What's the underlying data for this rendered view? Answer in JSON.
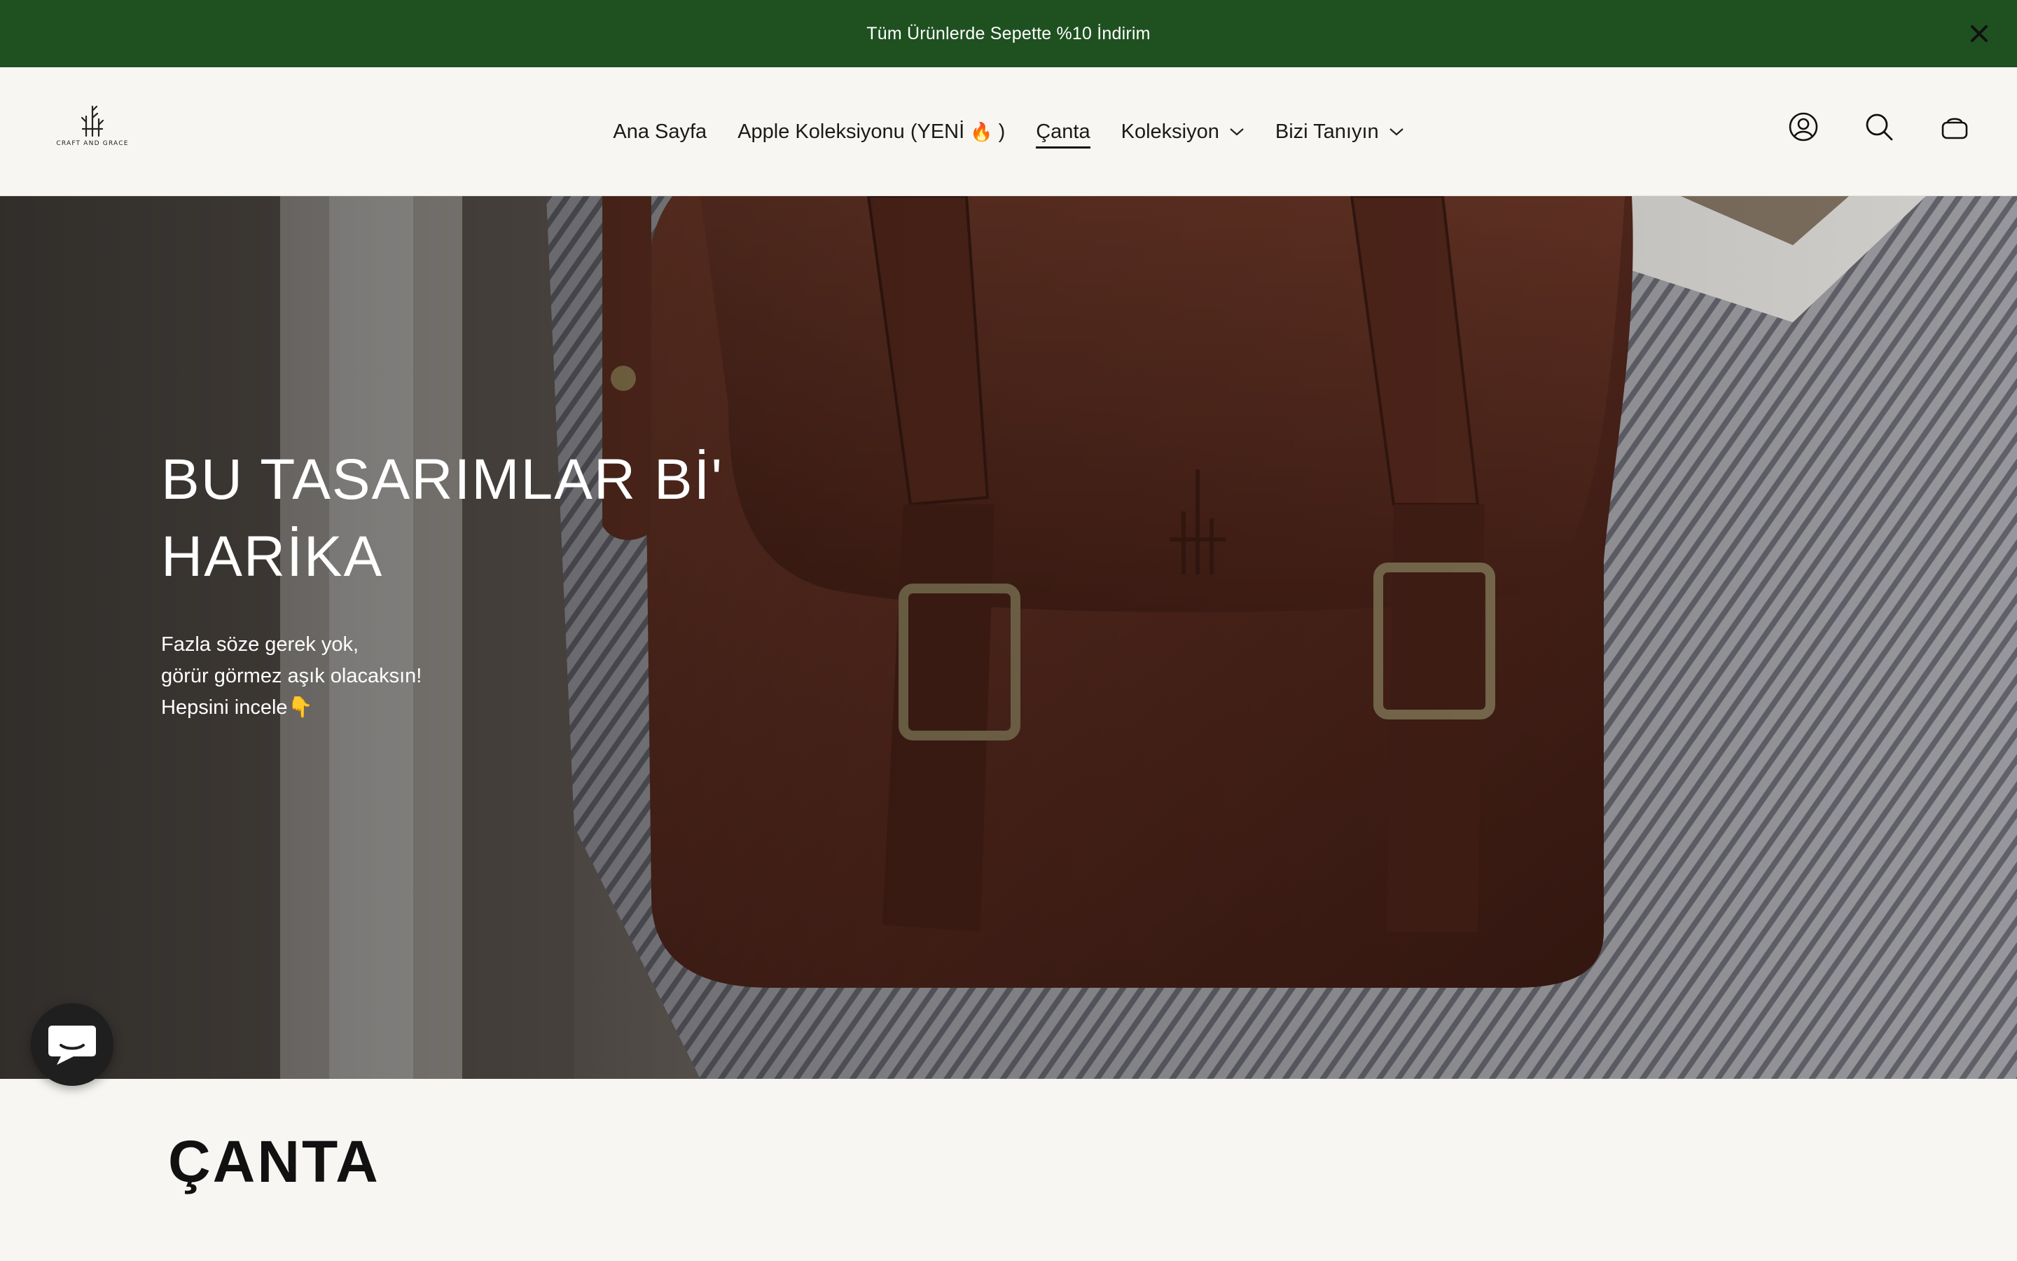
{
  "announcement": {
    "text": "Tüm Ürünlerde Sepette %10 İndirim",
    "close_icon": "close-icon",
    "bg_color": "#1f5120"
  },
  "header": {
    "logo_text": "CRAFT AND GRACE",
    "nav": [
      {
        "label": "Ana Sayfa"
      },
      {
        "label": "Apple Koleksiyonu (YENİ",
        "emoji": "🔥",
        "suffix": ")"
      },
      {
        "label": "Çanta"
      },
      {
        "label": "Koleksiyon"
      },
      {
        "label": "Bizi Tanıyın"
      }
    ],
    "active_nav": "Çanta",
    "icons": [
      "account-icon",
      "search-icon",
      "cart-icon"
    ]
  },
  "hero": {
    "title_line1": "BU TASARIMLAR Bİ'",
    "title_line2": "HARİKA",
    "subtitle_line1": "Fazla söze gerek yok,",
    "subtitle_line2": "görür görmez aşık olacaksın!",
    "subtitle_line3": "Hepsini incele",
    "subtitle_emoji": "👇"
  },
  "chat": {
    "icon": "chat-icon"
  },
  "section": {
    "title": "ÇANTA"
  }
}
